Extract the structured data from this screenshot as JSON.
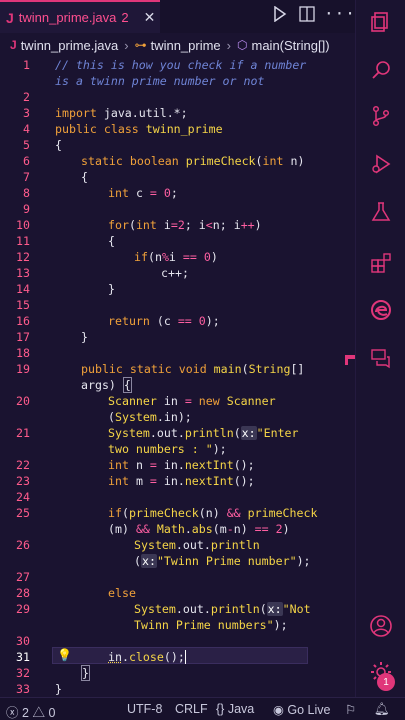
{
  "tab": {
    "icon": "J",
    "filename": "twinn_prime.java",
    "problems": "2",
    "close": "✕"
  },
  "breadcrumbs": {
    "file": "twinn_prime.java",
    "class": "twinn_prime",
    "method": "main(String[])"
  },
  "lines": [
    {
      "n": "1"
    },
    {
      "n": ""
    },
    {
      "n": "2"
    },
    {
      "n": "3"
    },
    {
      "n": "4"
    },
    {
      "n": "5"
    },
    {
      "n": "6"
    },
    {
      "n": "7"
    },
    {
      "n": "8"
    },
    {
      "n": "9"
    },
    {
      "n": "10"
    },
    {
      "n": "11"
    },
    {
      "n": "12"
    },
    {
      "n": "13"
    },
    {
      "n": "14"
    },
    {
      "n": "15"
    },
    {
      "n": "16"
    },
    {
      "n": "17"
    },
    {
      "n": "18"
    },
    {
      "n": "19"
    },
    {
      "n": ""
    },
    {
      "n": "20"
    },
    {
      "n": ""
    },
    {
      "n": "21"
    },
    {
      "n": ""
    },
    {
      "n": "22"
    },
    {
      "n": "23"
    },
    {
      "n": "24"
    },
    {
      "n": "25"
    },
    {
      "n": ""
    },
    {
      "n": "26"
    },
    {
      "n": ""
    },
    {
      "n": "27"
    },
    {
      "n": "28"
    },
    {
      "n": "29"
    },
    {
      "n": ""
    },
    {
      "n": "30"
    },
    {
      "n": "31"
    },
    {
      "n": "32"
    },
    {
      "n": "33"
    }
  ],
  "code": {
    "c1": "// this is how you check if a number",
    "c1b": "is a twinn prime number or not",
    "import_kw": "import",
    "import_pkg": " java.util.*;",
    "public": "public",
    "class": "class",
    "cls_name": "twinn_prime",
    "ob": "{",
    "cb": "}",
    "static": "static",
    "boolean": "boolean",
    "primeCheck": "primeCheck",
    "int": "int",
    "n": "n",
    "c": "c",
    "zero": "0",
    "semicolon": ";",
    "for": "for",
    "i": "i",
    "two": "2",
    "if": "if",
    "pct": "%",
    "eqeq": "==",
    "cpp": "c++;",
    "return": "return",
    "void": "void",
    "main": "main",
    "String": "String",
    "args": "args",
    "Scanner": "Scanner",
    "in": "in",
    "new": "new",
    "System": "System",
    "out": "out",
    "println": "println",
    "x_hint": "x:",
    "s_enter": "\"Enter",
    "s_two": "two numbers : \"",
    "m": "m",
    "nextInt": "nextInt",
    "and": "&&",
    "Math": "Math",
    "abs": "abs",
    "s_twinn": "\"Twinn Prime number\"",
    "else": "else",
    "s_not": "\"Not",
    "s_not2": "Twinn Prime numbers\"",
    "close": "close"
  },
  "status": {
    "errors": "2",
    "warnings": "0",
    "encoding": "UTF-8",
    "eol": "CRLF",
    "language": "Java",
    "golive": "Go Live"
  },
  "activity": {
    "account_badge": "1"
  }
}
